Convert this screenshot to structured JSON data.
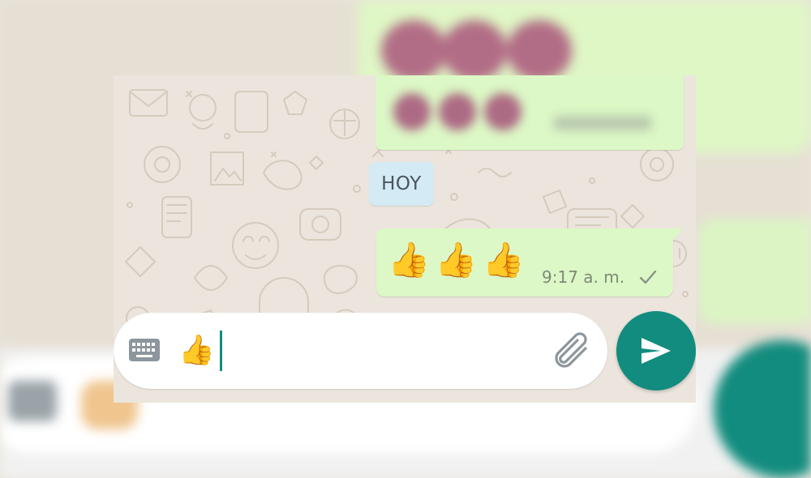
{
  "chat": {
    "date_divider": "HOY",
    "outgoing_message": {
      "emoji_text": "👍👍👍",
      "time": "9:17 a. m.",
      "status_icon": "single-check-icon"
    }
  },
  "composer": {
    "keyboard_icon": "keyboard-icon",
    "text": "👍",
    "attach_icon": "paperclip-icon",
    "send_icon": "send-arrow-icon"
  },
  "colors": {
    "wallpaper": "#ece5dd",
    "outgoing_bubble": "#dcf8c6",
    "date_chip": "#d4eaf4",
    "accent": "#128c7e"
  }
}
